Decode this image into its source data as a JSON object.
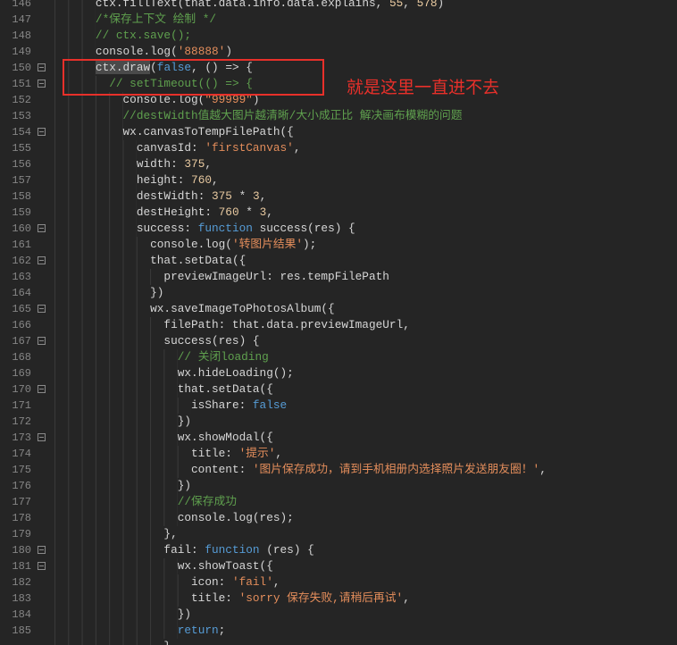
{
  "theme": {
    "background": "#252525",
    "text": "#d6d6d6",
    "line-number": "#858585",
    "keyword": "#569cd6",
    "string": "#e38d5b",
    "comment": "#5fa04e",
    "number": "#e8c9a0",
    "selection": "#4a4a4a",
    "indent-guide": "#3a3a3a",
    "fold-marker": "#8a8a8a",
    "annotation": "#e8302a"
  },
  "editor": {
    "lines": [
      {
        "number": "146",
        "fold": false,
        "indent_spaces": 6,
        "tokens": [
          {
            "type": "plain",
            "text": "ctx.fillText(that.data.info.data.explains, "
          },
          {
            "type": "number",
            "text": "55"
          },
          {
            "type": "plain",
            "text": ", "
          },
          {
            "type": "number",
            "text": "578"
          },
          {
            "type": "plain",
            "text": ")"
          }
        ]
      },
      {
        "number": "147",
        "fold": false,
        "indent_spaces": 6,
        "tokens": [
          {
            "type": "comment",
            "text": "/*保存上下文 绘制 */"
          }
        ]
      },
      {
        "number": "148",
        "fold": false,
        "indent_spaces": 6,
        "tokens": [
          {
            "type": "comment",
            "text": "// ctx.save();"
          }
        ]
      },
      {
        "number": "149",
        "fold": false,
        "indent_spaces": 6,
        "tokens": [
          {
            "type": "plain",
            "text": "console.log("
          },
          {
            "type": "string",
            "text": "'88888'"
          },
          {
            "type": "plain",
            "text": ")"
          }
        ]
      },
      {
        "number": "150",
        "fold": true,
        "indent_spaces": 6,
        "tokens": [
          {
            "type": "selected",
            "text": "ctx.draw"
          },
          {
            "type": "plain",
            "text": "("
          },
          {
            "type": "keyword",
            "text": "false"
          },
          {
            "type": "plain",
            "text": ", () => {"
          }
        ]
      },
      {
        "number": "151",
        "fold": true,
        "indent_spaces": 8,
        "tokens": [
          {
            "type": "comment",
            "text": "// setTimeout(() => {"
          }
        ]
      },
      {
        "number": "152",
        "fold": false,
        "indent_spaces": 10,
        "tokens": [
          {
            "type": "plain",
            "text": "console.log("
          },
          {
            "type": "string",
            "text": "\"99999\""
          },
          {
            "type": "plain",
            "text": ")"
          }
        ]
      },
      {
        "number": "153",
        "fold": false,
        "indent_spaces": 10,
        "tokens": [
          {
            "type": "comment",
            "text": "//destWidth值越大图片越清晰/大小成正比 解决画布模糊的问题"
          }
        ]
      },
      {
        "number": "154",
        "fold": true,
        "indent_spaces": 10,
        "tokens": [
          {
            "type": "plain",
            "text": "wx.canvasToTempFilePath({"
          }
        ]
      },
      {
        "number": "155",
        "fold": false,
        "indent_spaces": 12,
        "tokens": [
          {
            "type": "plain",
            "text": "canvasId: "
          },
          {
            "type": "string",
            "text": "'firstCanvas'"
          },
          {
            "type": "plain",
            "text": ","
          }
        ]
      },
      {
        "number": "156",
        "fold": false,
        "indent_spaces": 12,
        "tokens": [
          {
            "type": "plain",
            "text": "width: "
          },
          {
            "type": "number",
            "text": "375"
          },
          {
            "type": "plain",
            "text": ","
          }
        ]
      },
      {
        "number": "157",
        "fold": false,
        "indent_spaces": 12,
        "tokens": [
          {
            "type": "plain",
            "text": "height: "
          },
          {
            "type": "number",
            "text": "760"
          },
          {
            "type": "plain",
            "text": ","
          }
        ]
      },
      {
        "number": "158",
        "fold": false,
        "indent_spaces": 12,
        "tokens": [
          {
            "type": "plain",
            "text": "destWidth: "
          },
          {
            "type": "number",
            "text": "375"
          },
          {
            "type": "plain",
            "text": " * "
          },
          {
            "type": "number",
            "text": "3"
          },
          {
            "type": "plain",
            "text": ","
          }
        ]
      },
      {
        "number": "159",
        "fold": false,
        "indent_spaces": 12,
        "tokens": [
          {
            "type": "plain",
            "text": "destHeight: "
          },
          {
            "type": "number",
            "text": "760"
          },
          {
            "type": "plain",
            "text": " * "
          },
          {
            "type": "number",
            "text": "3"
          },
          {
            "type": "plain",
            "text": ","
          }
        ]
      },
      {
        "number": "160",
        "fold": true,
        "indent_spaces": 12,
        "tokens": [
          {
            "type": "plain",
            "text": "success: "
          },
          {
            "type": "keyword",
            "text": "function"
          },
          {
            "type": "plain",
            "text": " success(res) {"
          }
        ]
      },
      {
        "number": "161",
        "fold": false,
        "indent_spaces": 14,
        "tokens": [
          {
            "type": "plain",
            "text": "console.log("
          },
          {
            "type": "string",
            "text": "'转图片结果'"
          },
          {
            "type": "plain",
            "text": ");"
          }
        ]
      },
      {
        "number": "162",
        "fold": true,
        "indent_spaces": 14,
        "tokens": [
          {
            "type": "plain",
            "text": "that.setData({"
          }
        ]
      },
      {
        "number": "163",
        "fold": false,
        "indent_spaces": 16,
        "tokens": [
          {
            "type": "plain",
            "text": "previewImageUrl: res.tempFilePath"
          }
        ]
      },
      {
        "number": "164",
        "fold": false,
        "indent_spaces": 14,
        "tokens": [
          {
            "type": "plain",
            "text": "})"
          }
        ]
      },
      {
        "number": "165",
        "fold": true,
        "indent_spaces": 14,
        "tokens": [
          {
            "type": "plain",
            "text": "wx.saveImageToPhotosAlbum({"
          }
        ]
      },
      {
        "number": "166",
        "fold": false,
        "indent_spaces": 16,
        "tokens": [
          {
            "type": "plain",
            "text": "filePath: that.data.previewImageUrl,"
          }
        ]
      },
      {
        "number": "167",
        "fold": true,
        "indent_spaces": 16,
        "tokens": [
          {
            "type": "plain",
            "text": "success(res) {"
          }
        ]
      },
      {
        "number": "168",
        "fold": false,
        "indent_spaces": 18,
        "tokens": [
          {
            "type": "comment",
            "text": "// 关闭loading"
          }
        ]
      },
      {
        "number": "169",
        "fold": false,
        "indent_spaces": 18,
        "tokens": [
          {
            "type": "plain",
            "text": "wx.hideLoading();"
          }
        ]
      },
      {
        "number": "170",
        "fold": true,
        "indent_spaces": 18,
        "tokens": [
          {
            "type": "plain",
            "text": "that.setData({"
          }
        ]
      },
      {
        "number": "171",
        "fold": false,
        "indent_spaces": 20,
        "tokens": [
          {
            "type": "plain",
            "text": "isShare: "
          },
          {
            "type": "keyword",
            "text": "false"
          }
        ]
      },
      {
        "number": "172",
        "fold": false,
        "indent_spaces": 18,
        "tokens": [
          {
            "type": "plain",
            "text": "})"
          }
        ]
      },
      {
        "number": "173",
        "fold": true,
        "indent_spaces": 18,
        "tokens": [
          {
            "type": "plain",
            "text": "wx.showModal({"
          }
        ]
      },
      {
        "number": "174",
        "fold": false,
        "indent_spaces": 20,
        "tokens": [
          {
            "type": "plain",
            "text": "title: "
          },
          {
            "type": "string",
            "text": "'提示'"
          },
          {
            "type": "plain",
            "text": ","
          }
        ]
      },
      {
        "number": "175",
        "fold": false,
        "indent_spaces": 20,
        "tokens": [
          {
            "type": "plain",
            "text": "content: "
          },
          {
            "type": "string",
            "text": "'图片保存成功，请到手机相册内选择照片发送朋友圈！'"
          },
          {
            "type": "plain",
            "text": ","
          }
        ]
      },
      {
        "number": "176",
        "fold": false,
        "indent_spaces": 18,
        "tokens": [
          {
            "type": "plain",
            "text": "})"
          }
        ]
      },
      {
        "number": "177",
        "fold": false,
        "indent_spaces": 18,
        "tokens": [
          {
            "type": "comment",
            "text": "//保存成功"
          }
        ]
      },
      {
        "number": "178",
        "fold": false,
        "indent_spaces": 18,
        "tokens": [
          {
            "type": "plain",
            "text": "console.log(res);"
          }
        ]
      },
      {
        "number": "179",
        "fold": false,
        "indent_spaces": 16,
        "tokens": [
          {
            "type": "plain",
            "text": "},"
          }
        ]
      },
      {
        "number": "180",
        "fold": true,
        "indent_spaces": 16,
        "tokens": [
          {
            "type": "plain",
            "text": "fail: "
          },
          {
            "type": "keyword",
            "text": "function"
          },
          {
            "type": "plain",
            "text": " (res) {"
          }
        ]
      },
      {
        "number": "181",
        "fold": true,
        "indent_spaces": 18,
        "tokens": [
          {
            "type": "plain",
            "text": "wx.showToast({"
          }
        ]
      },
      {
        "number": "182",
        "fold": false,
        "indent_spaces": 20,
        "tokens": [
          {
            "type": "plain",
            "text": "icon: "
          },
          {
            "type": "string",
            "text": "'fail'"
          },
          {
            "type": "plain",
            "text": ","
          }
        ]
      },
      {
        "number": "183",
        "fold": false,
        "indent_spaces": 20,
        "tokens": [
          {
            "type": "plain",
            "text": "title: "
          },
          {
            "type": "string",
            "text": "'sorry 保存失败,请稍后再试'"
          },
          {
            "type": "plain",
            "text": ","
          }
        ]
      },
      {
        "number": "184",
        "fold": false,
        "indent_spaces": 18,
        "tokens": [
          {
            "type": "plain",
            "text": "})"
          }
        ]
      },
      {
        "number": "185",
        "fold": false,
        "indent_spaces": 18,
        "tokens": [
          {
            "type": "keyword",
            "text": "return"
          },
          {
            "type": "plain",
            "text": ";"
          }
        ]
      },
      {
        "fold": false,
        "indent_spaces": 16,
        "tokens": [
          {
            "type": "plain",
            "text": "}"
          }
        ]
      }
    ]
  },
  "annotation": {
    "text": "就是这里一直进不去"
  }
}
